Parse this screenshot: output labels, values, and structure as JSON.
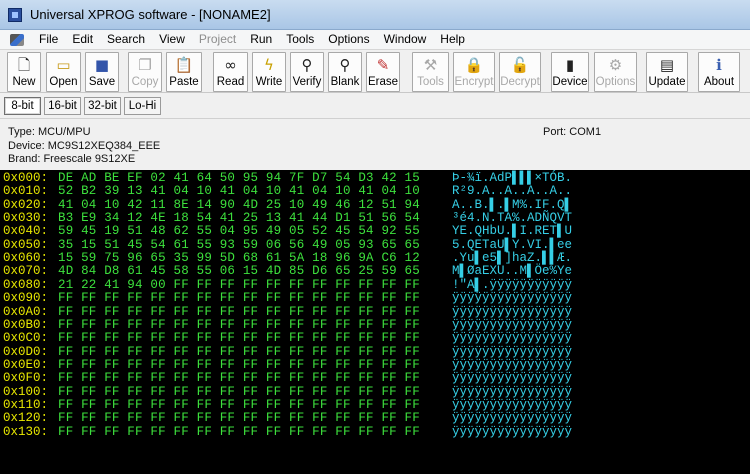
{
  "window": {
    "title": "Universal XPROG software - [NONAME2]"
  },
  "menu": [
    {
      "label": "File",
      "disabled": false
    },
    {
      "label": "Edit",
      "disabled": false
    },
    {
      "label": "Search",
      "disabled": false
    },
    {
      "label": "View",
      "disabled": false
    },
    {
      "label": "Project",
      "disabled": true
    },
    {
      "label": "Run",
      "disabled": false
    },
    {
      "label": "Tools",
      "disabled": false
    },
    {
      "label": "Options",
      "disabled": false
    },
    {
      "label": "Window",
      "disabled": false
    },
    {
      "label": "Help",
      "disabled": false
    }
  ],
  "toolbar": [
    {
      "label": "New",
      "icon": "new-file-icon",
      "disabled": false
    },
    {
      "label": "Open",
      "icon": "open-folder-icon",
      "disabled": false
    },
    {
      "label": "Save",
      "icon": "save-disk-icon",
      "disabled": false
    },
    {
      "label": "Copy",
      "icon": "copy-icon",
      "disabled": true
    },
    {
      "label": "Paste",
      "icon": "paste-icon",
      "disabled": false
    },
    {
      "label": "Read",
      "icon": "read-glasses-icon",
      "disabled": false
    },
    {
      "label": "Write",
      "icon": "write-lightning-icon",
      "disabled": false
    },
    {
      "label": "Verify",
      "icon": "verify-magnifier-icon",
      "disabled": false
    },
    {
      "label": "Blank",
      "icon": "blank-check-icon",
      "disabled": false
    },
    {
      "label": "Erase",
      "icon": "erase-icon",
      "disabled": false
    },
    {
      "label": "Tools",
      "icon": "tools-icon",
      "disabled": true
    },
    {
      "label": "Encrypt",
      "icon": "lock-icon",
      "disabled": true
    },
    {
      "label": "Decrypt",
      "icon": "unlock-icon",
      "disabled": true
    },
    {
      "label": "Device",
      "icon": "device-chip-icon",
      "disabled": false
    },
    {
      "label": "Options",
      "icon": "options-icon",
      "disabled": true
    },
    {
      "label": "Update",
      "icon": "update-icon",
      "disabled": false
    },
    {
      "label": "About",
      "icon": "about-icon",
      "disabled": false
    }
  ],
  "tabs": [
    {
      "label": "8-bit",
      "active": true
    },
    {
      "label": "16-bit",
      "active": false
    },
    {
      "label": "32-bit",
      "active": false
    },
    {
      "label": "Lo-Hi",
      "active": false
    }
  ],
  "info": {
    "type": "Type: MCU/MPU",
    "device": "Device: MC9S12XEQ384_EEE",
    "brand": "Brand: Freescale 9S12XE",
    "port": "Port: COM1"
  },
  "hex_rows": [
    {
      "addr": "0x000:",
      "bytes": "DE AD BE EF 02 41 64 50 95 94 7F D7 54 D3 42 15",
      "ascii": "Þ-¾ï.AdP▌▌▌×TÓB."
    },
    {
      "addr": "0x010:",
      "bytes": "52 B2 39 13 41 04 10 41 04 10 41 04 10 41 04 10",
      "ascii": "R²9.A..A..A..A.."
    },
    {
      "addr": "0x020:",
      "bytes": "41 04 10 42 11 8E 14 90 4D 25 10 49 46 12 51 94",
      "ascii": "A..B.▌.▌M%.IF.Q▌"
    },
    {
      "addr": "0x030:",
      "bytes": "B3 E9 34 12 4E 18 54 41 25 13 41 44 D1 51 56 54",
      "ascii": "³é4.N.TA%.ADÑQVT"
    },
    {
      "addr": "0x040:",
      "bytes": "59 45 19 51 48 62 55 04 95 49 05 52 45 54 92 55",
      "ascii": "YE.QHbU.▌I.RET▌U"
    },
    {
      "addr": "0x050:",
      "bytes": "35 15 51 45 54 61 55 93 59 06 56 49 05 93 65 65",
      "ascii": "5.QETaU▌Y.VI.▌ee"
    },
    {
      "addr": "0x060:",
      "bytes": "15 59 75 96 65 35 99 5D 68 61 5A 18 96 9A C6 12",
      "ascii": ".Yu▌e5▌]haZ.▌▌Æ."
    },
    {
      "addr": "0x070:",
      "bytes": "4D 84 D8 61 45 58 55 06 15 4D 85 D6 65 25 59 65",
      "ascii": "M▌ØaEXU..M▌Öe%Ye"
    },
    {
      "addr": "0x080:",
      "bytes": "21 22 41 94 00 FF FF FF FF FF FF FF FF FF FF FF",
      "ascii": "!\"A▌.ÿÿÿÿÿÿÿÿÿÿÿ"
    },
    {
      "addr": "0x090:",
      "bytes": "FF FF FF FF FF FF FF FF FF FF FF FF FF FF FF FF",
      "ascii": "ÿÿÿÿÿÿÿÿÿÿÿÿÿÿÿÿ"
    },
    {
      "addr": "0x0A0:",
      "bytes": "FF FF FF FF FF FF FF FF FF FF FF FF FF FF FF FF",
      "ascii": "ÿÿÿÿÿÿÿÿÿÿÿÿÿÿÿÿ"
    },
    {
      "addr": "0x0B0:",
      "bytes": "FF FF FF FF FF FF FF FF FF FF FF FF FF FF FF FF",
      "ascii": "ÿÿÿÿÿÿÿÿÿÿÿÿÿÿÿÿ"
    },
    {
      "addr": "0x0C0:",
      "bytes": "FF FF FF FF FF FF FF FF FF FF FF FF FF FF FF FF",
      "ascii": "ÿÿÿÿÿÿÿÿÿÿÿÿÿÿÿÿ"
    },
    {
      "addr": "0x0D0:",
      "bytes": "FF FF FF FF FF FF FF FF FF FF FF FF FF FF FF FF",
      "ascii": "ÿÿÿÿÿÿÿÿÿÿÿÿÿÿÿÿ"
    },
    {
      "addr": "0x0E0:",
      "bytes": "FF FF FF FF FF FF FF FF FF FF FF FF FF FF FF FF",
      "ascii": "ÿÿÿÿÿÿÿÿÿÿÿÿÿÿÿÿ"
    },
    {
      "addr": "0x0F0:",
      "bytes": "FF FF FF FF FF FF FF FF FF FF FF FF FF FF FF FF",
      "ascii": "ÿÿÿÿÿÿÿÿÿÿÿÿÿÿÿÿ"
    },
    {
      "addr": "0x100:",
      "bytes": "FF FF FF FF FF FF FF FF FF FF FF FF FF FF FF FF",
      "ascii": "ÿÿÿÿÿÿÿÿÿÿÿÿÿÿÿÿ"
    },
    {
      "addr": "0x110:",
      "bytes": "FF FF FF FF FF FF FF FF FF FF FF FF FF FF FF FF",
      "ascii": "ÿÿÿÿÿÿÿÿÿÿÿÿÿÿÿÿ"
    },
    {
      "addr": "0x120:",
      "bytes": "FF FF FF FF FF FF FF FF FF FF FF FF FF FF FF FF",
      "ascii": "ÿÿÿÿÿÿÿÿÿÿÿÿÿÿÿÿ"
    },
    {
      "addr": "0x130:",
      "bytes": "FF FF FF FF FF FF FF FF FF FF FF FF FF FF FF FF",
      "ascii": "ÿÿÿÿÿÿÿÿÿÿÿÿÿÿÿÿ"
    }
  ],
  "colors": {
    "address": "#e8e800",
    "bytes": "#3de13d",
    "ascii": "#36cfe6",
    "background": "#000000"
  }
}
